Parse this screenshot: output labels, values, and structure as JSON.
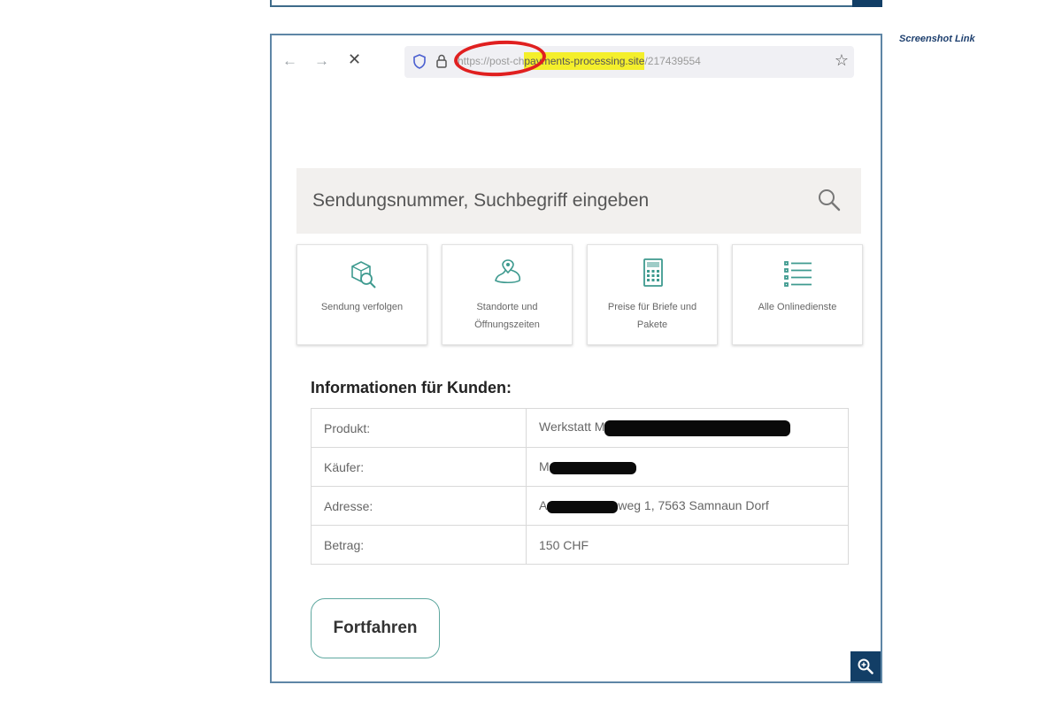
{
  "caption": "Screenshot Link",
  "browser": {
    "url_prefix": "https://post-ch",
    "url_highlight": "payments-processing.site",
    "url_suffix": "/217439554"
  },
  "search": {
    "placeholder": "Sendungsnummer, Suchbegriff eingeben"
  },
  "tiles": [
    {
      "label": "Sendung verfolgen",
      "icon": "parcel-search-icon"
    },
    {
      "label": "Standorte und Öffnungszeiten",
      "icon": "location-map-icon"
    },
    {
      "label": "Preise für Briefe und Pakete",
      "icon": "calculator-icon"
    },
    {
      "label": "Alle Onlinedienste",
      "icon": "list-icon"
    }
  ],
  "info": {
    "title": "Informationen für Kunden:",
    "rows": [
      {
        "key": "Produkt:",
        "value": "Werkstatt M"
      },
      {
        "key": "Käufer:",
        "value": "M"
      },
      {
        "key": "Adresse:",
        "value_prefix": "A",
        "value_suffix": "weg 1, 7563 Samnaun Dorf"
      },
      {
        "key": "Betrag:",
        "value": "150 CHF"
      }
    ]
  },
  "continue_label": "Fortfahren",
  "colors": {
    "frame": "#5e86a6",
    "accent_teal": "#5fa8a0",
    "highlight": "#f4ef2c",
    "circle": "#e02020",
    "navy": "#123e66"
  }
}
